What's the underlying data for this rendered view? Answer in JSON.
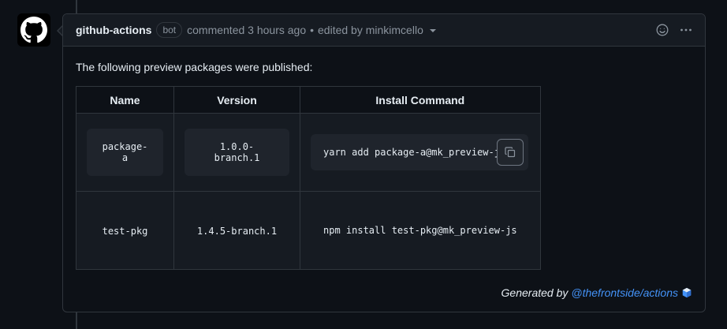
{
  "comment": {
    "author": "github-actions",
    "badge": "bot",
    "commented_text": "commented 3 hours ago",
    "separator": "•",
    "edited_text": "edited by minkimcello",
    "intro": "The following preview packages were published:",
    "table": {
      "headers": [
        "Name",
        "Version",
        "Install Command"
      ],
      "rows": [
        {
          "name": "package-a",
          "version": "1.0.0-branch.1",
          "command": "yarn add package-a@mk_preview-js"
        },
        {
          "name": "test-pkg",
          "version": "1.4.5-branch.1",
          "command": "npm install test-pkg@mk_preview-js"
        }
      ]
    },
    "footer": {
      "prefix": "Generated by",
      "link": "@thefrontside/actions"
    }
  },
  "icons": {
    "avatar": "github-octocat-icon",
    "emoji": "smiley-icon",
    "menu": "kebab-horizontal-icon",
    "copy": "copy-icon",
    "edited_dropdown": "chevron-down-icon",
    "footer_logo": "cube-icon"
  },
  "colors": {
    "background": "#0d1117",
    "header_bg": "#161b22",
    "border": "#30363d",
    "link": "#4493f8",
    "muted": "#8b949e"
  }
}
